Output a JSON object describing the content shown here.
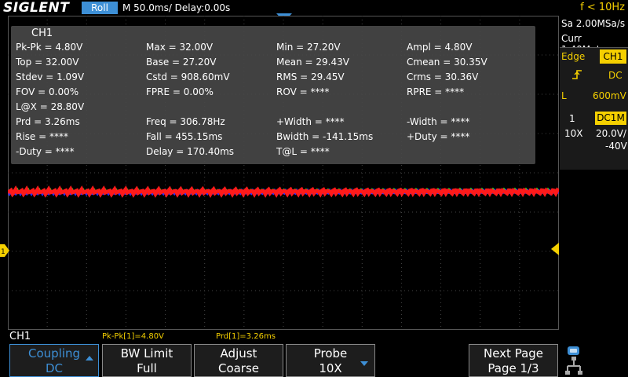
{
  "header": {
    "brand": "SIGLENT",
    "mode": "Roll",
    "timebase": "M 50.0ms/ Delay:0.00s",
    "trigger_freq": "f < 10Hz"
  },
  "right_panel": {
    "sample_rate": "Sa 2.00MSa/s",
    "memory": "Curr 1.40Mpts",
    "trigger_type_label": "Edge",
    "trigger_source": "CH1",
    "trigger_slope_icon": "rising-edge-icon",
    "trigger_coupling": "DC",
    "trigger_level_label": "L",
    "trigger_level": "600mV",
    "channel_num": "1",
    "channel_coupling": "DC1M",
    "probe": "10X",
    "volts_div": "20.0V/",
    "offset": "-40V"
  },
  "measurements": {
    "title": "CH1",
    "rows": [
      [
        "Pk-Pk = 4.80V",
        "Max = 32.00V",
        "Min = 27.20V",
        "Ampl = 4.80V"
      ],
      [
        "Top = 32.00V",
        "Base = 27.20V",
        "Mean = 29.43V",
        "Cmean = 30.35V"
      ],
      [
        "Stdev = 1.09V",
        "Cstd = 908.60mV",
        "RMS = 29.45V",
        "Crms = 30.36V"
      ],
      [
        "FOV = 0.00%",
        "FPRE = 0.00%",
        "ROV = ****",
        "RPRE = ****"
      ],
      [
        "L@X = 28.80V",
        "",
        "",
        ""
      ],
      [
        "Prd = 3.26ms",
        "Freq = 306.78Hz",
        "+Width = ****",
        "-Width = ****"
      ],
      [
        "Rise = ****",
        "Fall = 455.15ms",
        "Bwidth = -141.15ms",
        "+Duty = ****"
      ],
      [
        "-Duty = ****",
        "Delay = 170.40ms",
        "T@L = ****",
        ""
      ]
    ]
  },
  "channel_marker": "1",
  "bottom": {
    "channel": "CH1",
    "meas1": "Pk-Pk[1]=4.80V",
    "meas2": "Prd[1]=3.26ms"
  },
  "softkeys": [
    {
      "line1": "Coupling",
      "line2": "DC"
    },
    {
      "line1": "BW Limit",
      "line2": "Full"
    },
    {
      "line1": "Adjust",
      "line2": "Coarse"
    },
    {
      "line1": "Probe",
      "line2": "10X"
    },
    {
      "line1": "Next Page",
      "line2": "Page 1/3"
    }
  ],
  "colors": {
    "accent": "#3d8fd6",
    "ch1": "#f5d000",
    "trace_red": "#ff1a1a",
    "trace_blue": "#3030ff",
    "trace_green": "#30ff30"
  }
}
